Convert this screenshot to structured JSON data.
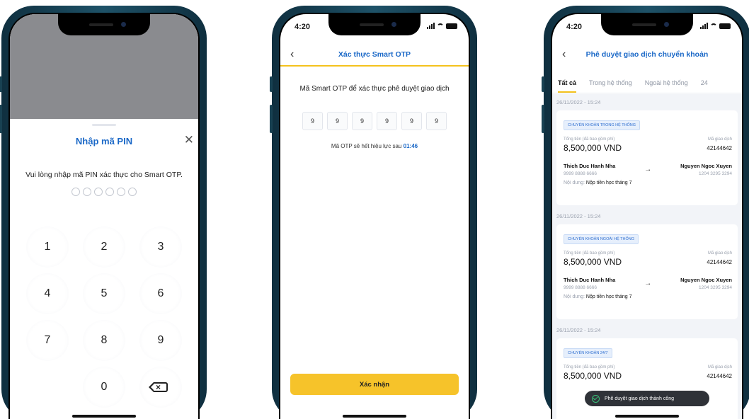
{
  "phone1": {
    "sheet_title": "Nhập mã PIN",
    "close_glyph": "✕",
    "description": "Vui lòng nhập mã PIN xác thực cho Smart OTP.",
    "pin_length": 6,
    "keys": [
      "1",
      "2",
      "3",
      "4",
      "5",
      "6",
      "7",
      "8",
      "9",
      "",
      "0",
      "delete"
    ]
  },
  "phone2": {
    "time": "4:20",
    "back_glyph": "‹",
    "title": "Xác thực Smart OTP",
    "description": "Mã Smart OTP để xác thực phê duyệt giao dịch",
    "otp_digits": [
      "9",
      "9",
      "9",
      "9",
      "9",
      "9"
    ],
    "expire_text": "Mã OTP sẽ hết hiệu lực sau",
    "expire_time": "01:46",
    "confirm_label": "Xác nhận"
  },
  "phone3": {
    "time": "4:20",
    "back_glyph": "‹",
    "title": "Phê duyệt giao dịch chuyển khoản",
    "tabs": [
      {
        "label": "Tất cả",
        "active": true
      },
      {
        "label": "Trong hệ thống",
        "active": false
      },
      {
        "label": "Ngoài hệ thống",
        "active": false
      },
      {
        "label": "24",
        "active": false
      }
    ],
    "amount_label": "Tổng tiền (đã bao gồm phí)",
    "txid_label": "Mã giao dịch",
    "content_label": "Nội dung:",
    "transactions": [
      {
        "date": "26/11/2022 - 15:24",
        "tag": "CHUYỂN KHOẢN TRONG HỆ THỐNG",
        "amount": "8,500,000 VND",
        "txid": "42144642",
        "from_name": "Thich Duc Hanh Nha",
        "from_acc": "9999 8888 6666",
        "to_name": "Nguyen Ngoc Xuyen",
        "to_acc": "1204 3295 3294",
        "content": "Nộp tiền học tháng 7"
      },
      {
        "date": "26/11/2022 - 15:24",
        "tag": "CHUYỂN KHOẢN NGOÀI HỆ THỐNG",
        "amount": "8,500,000 VND",
        "txid": "42144642",
        "from_name": "Thich Duc Hanh Nha",
        "from_acc": "9999 8888 6666",
        "to_name": "Nguyen Ngoc Xuyen",
        "to_acc": "1204 3295 3294",
        "content": "Nộp tiền học tháng 7"
      },
      {
        "date": "26/11/2022 - 15:24",
        "tag": "CHUYỂN KHOẢN 24/7",
        "amount": "8,500,000 VND",
        "txid": "42144642",
        "from_name": "",
        "from_acc": "",
        "to_name": "",
        "to_acc": "",
        "content": ""
      }
    ],
    "arrow_glyph": "→",
    "toast": "Phê duyệt giao dịch thành công"
  }
}
